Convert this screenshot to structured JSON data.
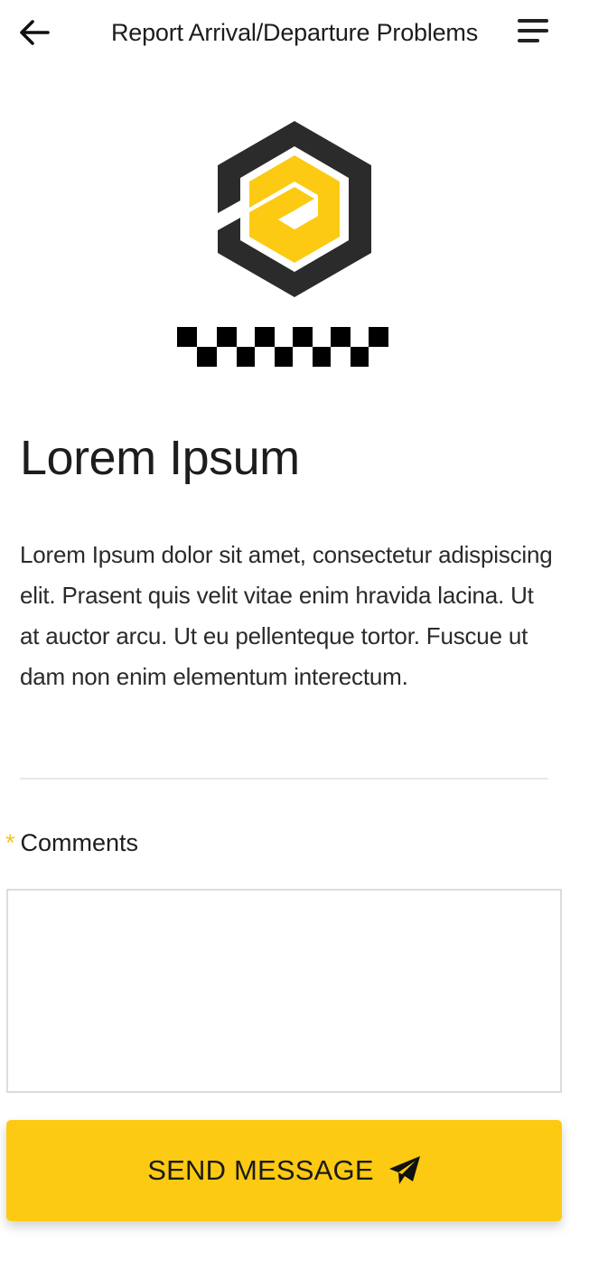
{
  "header": {
    "title": "Report Arrival/Departure Problems",
    "back_icon": "arrow-left-icon",
    "menu_icon": "menu-icon"
  },
  "logo": {
    "emblem_icon": "hexagon-logo-icon",
    "pattern": "checkered-taxi-stripe",
    "colors": {
      "dark": "#2b2b2b",
      "accent": "#fcca12"
    }
  },
  "content": {
    "headline": "Lorem Ipsum",
    "body": "Lorem Ipsum dolor sit amet, consectetur adispiscing elit. Prasent quis velit vitae enim hravida lacina. Ut at auctor arcu. Ut eu pellenteque tortor. Fuscue ut dam non enim elementum interectum."
  },
  "form": {
    "comments_required_mark": "*",
    "comments_label": "Comments",
    "comments_value": "",
    "send_label": "SEND MESSAGE",
    "send_icon": "paper-plane-icon"
  },
  "colors": {
    "accent": "#fcca12",
    "text": "#1d1d1d",
    "divider": "#e9e9e9",
    "input_border": "#dcdcdc"
  }
}
